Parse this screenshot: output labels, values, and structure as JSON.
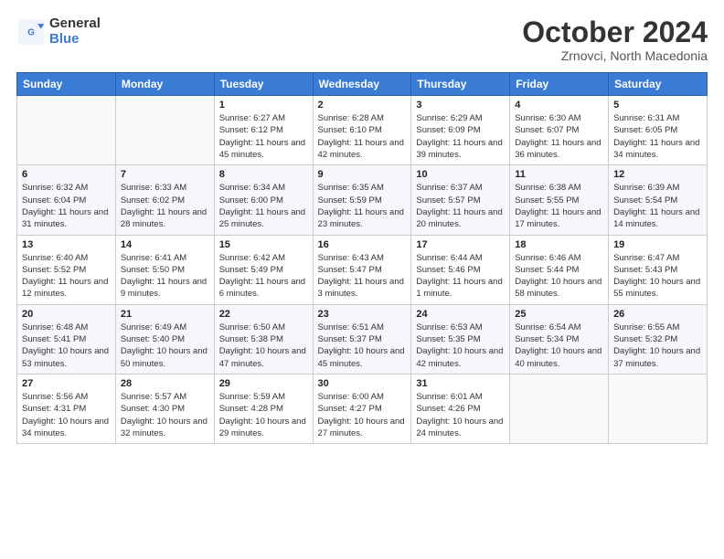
{
  "logo": {
    "general": "General",
    "blue": "Blue"
  },
  "title": "October 2024",
  "location": "Zrnovci, North Macedonia",
  "days_header": [
    "Sunday",
    "Monday",
    "Tuesday",
    "Wednesday",
    "Thursday",
    "Friday",
    "Saturday"
  ],
  "weeks": [
    [
      {
        "day": "",
        "info": ""
      },
      {
        "day": "",
        "info": ""
      },
      {
        "day": "1",
        "info": "Sunrise: 6:27 AM\nSunset: 6:12 PM\nDaylight: 11 hours and 45 minutes."
      },
      {
        "day": "2",
        "info": "Sunrise: 6:28 AM\nSunset: 6:10 PM\nDaylight: 11 hours and 42 minutes."
      },
      {
        "day": "3",
        "info": "Sunrise: 6:29 AM\nSunset: 6:09 PM\nDaylight: 11 hours and 39 minutes."
      },
      {
        "day": "4",
        "info": "Sunrise: 6:30 AM\nSunset: 6:07 PM\nDaylight: 11 hours and 36 minutes."
      },
      {
        "day": "5",
        "info": "Sunrise: 6:31 AM\nSunset: 6:05 PM\nDaylight: 11 hours and 34 minutes."
      }
    ],
    [
      {
        "day": "6",
        "info": "Sunrise: 6:32 AM\nSunset: 6:04 PM\nDaylight: 11 hours and 31 minutes."
      },
      {
        "day": "7",
        "info": "Sunrise: 6:33 AM\nSunset: 6:02 PM\nDaylight: 11 hours and 28 minutes."
      },
      {
        "day": "8",
        "info": "Sunrise: 6:34 AM\nSunset: 6:00 PM\nDaylight: 11 hours and 25 minutes."
      },
      {
        "day": "9",
        "info": "Sunrise: 6:35 AM\nSunset: 5:59 PM\nDaylight: 11 hours and 23 minutes."
      },
      {
        "day": "10",
        "info": "Sunrise: 6:37 AM\nSunset: 5:57 PM\nDaylight: 11 hours and 20 minutes."
      },
      {
        "day": "11",
        "info": "Sunrise: 6:38 AM\nSunset: 5:55 PM\nDaylight: 11 hours and 17 minutes."
      },
      {
        "day": "12",
        "info": "Sunrise: 6:39 AM\nSunset: 5:54 PM\nDaylight: 11 hours and 14 minutes."
      }
    ],
    [
      {
        "day": "13",
        "info": "Sunrise: 6:40 AM\nSunset: 5:52 PM\nDaylight: 11 hours and 12 minutes."
      },
      {
        "day": "14",
        "info": "Sunrise: 6:41 AM\nSunset: 5:50 PM\nDaylight: 11 hours and 9 minutes."
      },
      {
        "day": "15",
        "info": "Sunrise: 6:42 AM\nSunset: 5:49 PM\nDaylight: 11 hours and 6 minutes."
      },
      {
        "day": "16",
        "info": "Sunrise: 6:43 AM\nSunset: 5:47 PM\nDaylight: 11 hours and 3 minutes."
      },
      {
        "day": "17",
        "info": "Sunrise: 6:44 AM\nSunset: 5:46 PM\nDaylight: 11 hours and 1 minute."
      },
      {
        "day": "18",
        "info": "Sunrise: 6:46 AM\nSunset: 5:44 PM\nDaylight: 10 hours and 58 minutes."
      },
      {
        "day": "19",
        "info": "Sunrise: 6:47 AM\nSunset: 5:43 PM\nDaylight: 10 hours and 55 minutes."
      }
    ],
    [
      {
        "day": "20",
        "info": "Sunrise: 6:48 AM\nSunset: 5:41 PM\nDaylight: 10 hours and 53 minutes."
      },
      {
        "day": "21",
        "info": "Sunrise: 6:49 AM\nSunset: 5:40 PM\nDaylight: 10 hours and 50 minutes."
      },
      {
        "day": "22",
        "info": "Sunrise: 6:50 AM\nSunset: 5:38 PM\nDaylight: 10 hours and 47 minutes."
      },
      {
        "day": "23",
        "info": "Sunrise: 6:51 AM\nSunset: 5:37 PM\nDaylight: 10 hours and 45 minutes."
      },
      {
        "day": "24",
        "info": "Sunrise: 6:53 AM\nSunset: 5:35 PM\nDaylight: 10 hours and 42 minutes."
      },
      {
        "day": "25",
        "info": "Sunrise: 6:54 AM\nSunset: 5:34 PM\nDaylight: 10 hours and 40 minutes."
      },
      {
        "day": "26",
        "info": "Sunrise: 6:55 AM\nSunset: 5:32 PM\nDaylight: 10 hours and 37 minutes."
      }
    ],
    [
      {
        "day": "27",
        "info": "Sunrise: 5:56 AM\nSunset: 4:31 PM\nDaylight: 10 hours and 34 minutes."
      },
      {
        "day": "28",
        "info": "Sunrise: 5:57 AM\nSunset: 4:30 PM\nDaylight: 10 hours and 32 minutes."
      },
      {
        "day": "29",
        "info": "Sunrise: 5:59 AM\nSunset: 4:28 PM\nDaylight: 10 hours and 29 minutes."
      },
      {
        "day": "30",
        "info": "Sunrise: 6:00 AM\nSunset: 4:27 PM\nDaylight: 10 hours and 27 minutes."
      },
      {
        "day": "31",
        "info": "Sunrise: 6:01 AM\nSunset: 4:26 PM\nDaylight: 10 hours and 24 minutes."
      },
      {
        "day": "",
        "info": ""
      },
      {
        "day": "",
        "info": ""
      }
    ]
  ]
}
